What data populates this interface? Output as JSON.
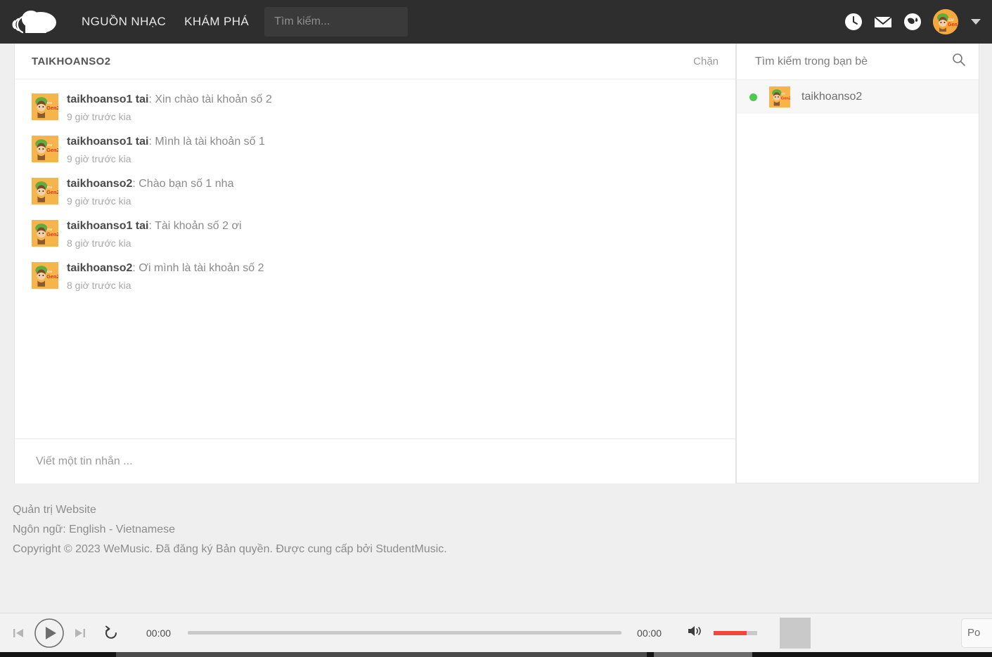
{
  "header": {
    "logo_name": "soundcloud-logo",
    "nav": [
      {
        "label": "NGUỒN NHẠC",
        "name": "nav-nguon-nhac"
      },
      {
        "label": "KHÁM PHÁ",
        "name": "nav-kham-pha"
      }
    ],
    "search": {
      "value": "",
      "placeholder": "Tìm kiếm..."
    },
    "icons": [
      "history-clock-icon",
      "mail-envelope-icon",
      "globe-icon"
    ],
    "avatar_alt": "user-avatar",
    "chevron": "chevron-down-icon"
  },
  "chat": {
    "title": "TAIKHOANSO2",
    "block_label": "Chặn",
    "messages": [
      {
        "user": "taikhoanso1 tai",
        "sep": ": ",
        "text": "Xin chào tài khoản số 2",
        "time": "9 giờ trước kia"
      },
      {
        "user": "taikhoanso1 tai",
        "sep": ": ",
        "text": "Mình là tài khoản số 1",
        "time": "9 giờ trước kia"
      },
      {
        "user": "taikhoanso2",
        "sep": ": ",
        "text": "Chào bạn số 1 nha",
        "time": "9 giờ trước kia"
      },
      {
        "user": "taikhoanso1 tai",
        "sep": ": ",
        "text": "Tài khoản số 2 ơi",
        "time": "8 giờ trước kia"
      },
      {
        "user": "taikhoanso2",
        "sep": ": ",
        "text": "Ơi mình là tài khoản số 2",
        "time": "8 giờ trước kia"
      }
    ],
    "composer": {
      "value": "",
      "placeholder": "Viết một tin nhắn ..."
    }
  },
  "friends": {
    "search": {
      "value": "",
      "placeholder": "Tìm kiếm trong bạn bè"
    },
    "search_icon": "search-icon",
    "list": [
      {
        "name": "taikhoanso2",
        "status": "online",
        "status_color": "#4ec94e"
      }
    ]
  },
  "footer": {
    "admin_link": "Quản trị Website",
    "language_line": "Ngôn ngữ: English - Vietnamese",
    "copyright": "Copyright © 2023 WeMusic. Đã đăng ký Bản quyền. Được cung cấp bởi StudentMusic."
  },
  "player": {
    "prev": "previous-track-icon",
    "play": "play-icon",
    "next": "next-track-icon",
    "repeat": "repeat-icon",
    "current_time": "00:00",
    "total_time": "00:00",
    "progress_percent": 0,
    "volume_icon": "volume-icon",
    "volume_percent": 75,
    "volume_color": "#f1453d",
    "popup_label": "Po"
  }
}
